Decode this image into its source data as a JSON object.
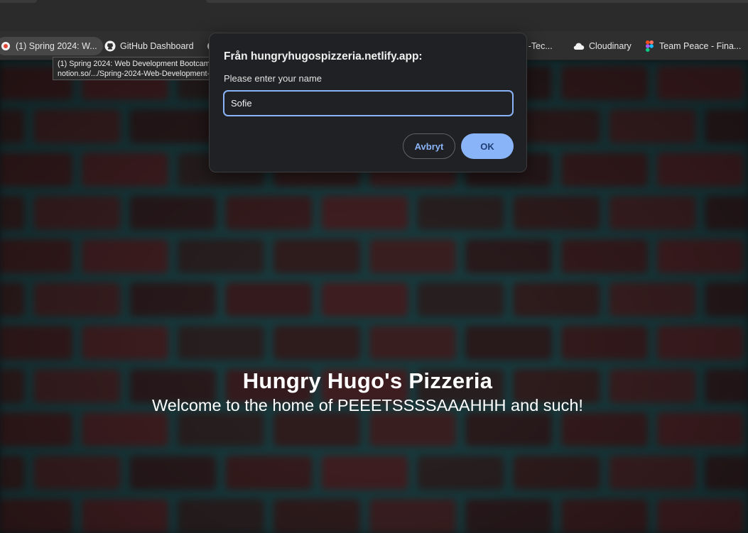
{
  "browser": {
    "bookmarks": [
      {
        "label": "(1) Spring 2024: W...",
        "icon": "notion-icon"
      },
      {
        "label": "GitHub Dashboard",
        "icon": "github-icon"
      },
      {
        "label": "s -Tec...",
        "icon": "page-icon"
      },
      {
        "label": "Cloudinary",
        "icon": "cloud-icon"
      },
      {
        "label": "Team Peace - Fina...",
        "icon": "figma-icon"
      }
    ],
    "tooltip": {
      "line1": "(1) Spring 2024: Web Development Bootcamp",
      "line2": "notion.so/.../Spring-2024-Web-Development-..."
    }
  },
  "dialog": {
    "origin": "Från hungryhugospizzeria.netlify.app:",
    "message": "Please enter your name",
    "input_value": "Sofie",
    "cancel_label": "Avbryt",
    "ok_label": "OK"
  },
  "page": {
    "title": "Hungry Hugo's Pizzeria",
    "subtitle": "Welcome to the home of PEEETSSSSAAAHHH and such!"
  },
  "colors": {
    "accent": "#8ab4f8",
    "dialog_bg": "#202124",
    "page_bg": "#14272b"
  }
}
